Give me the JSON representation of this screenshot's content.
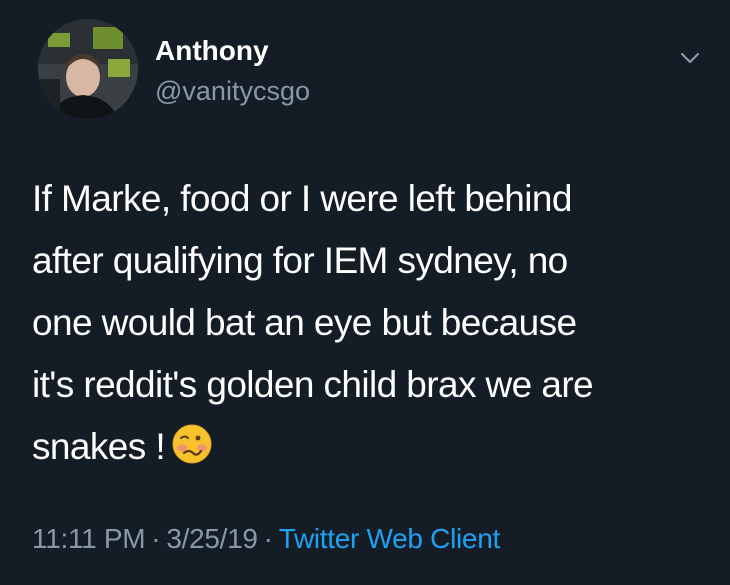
{
  "user": {
    "display_name": "Anthony",
    "handle": "@vanitycsgo"
  },
  "tweet": {
    "lines": [
      "If Marke, food or I were left behind",
      "after qualifying for IEM sydney, no",
      "one would bat an eye but because",
      "it's reddit's golden child brax we are",
      "snakes !"
    ],
    "emoji": "woozy-face"
  },
  "meta": {
    "time": "11:11 PM",
    "separator": "·",
    "date": "3/25/19",
    "client": "Twitter Web Client"
  },
  "colors": {
    "background": "#141d26",
    "text": "#ffffff",
    "secondary": "#8899a6",
    "link": "#1da1f2"
  }
}
